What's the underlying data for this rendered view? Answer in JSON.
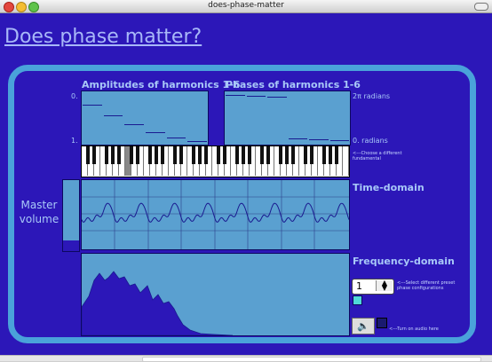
{
  "window": {
    "title": "does-phase-matter"
  },
  "page": {
    "heading": "Does phase matter?"
  },
  "panels": {
    "amplitudes_title": "Amplitudes of harmonics 1-6",
    "phases_title": "Phases of harmonics 1-6",
    "amp_top": "0.",
    "amp_bottom": "1.",
    "phase_top": "2π radians",
    "phase_bottom": "0. radians",
    "amplitude_levels": [
      0.25,
      0.46,
      0.64,
      0.79,
      0.9,
      0.96
    ],
    "phase_levels": [
      0.93,
      0.91,
      0.9,
      0.08,
      0.07,
      0.06
    ]
  },
  "keyboard": {
    "hint": "<---Choose a different fundamental",
    "selected_white_key": 7
  },
  "master": {
    "label": "Master volume",
    "level": 0.15
  },
  "time_domain": {
    "title": "Time-domain"
  },
  "frequency_domain": {
    "title": "Frequency-domain",
    "preset_value": "1",
    "preset_hint": "<---Select different preset phase configurations",
    "audio_hint": "<---Turn on audio here"
  },
  "colors": {
    "background": "#2c17b8",
    "panel": "#5aa0d0",
    "frame": "#4aa2da",
    "trace": "#1a1a90"
  },
  "icons": {
    "audio": "speaker-icon",
    "spinner": "up-down-arrows-icon"
  }
}
